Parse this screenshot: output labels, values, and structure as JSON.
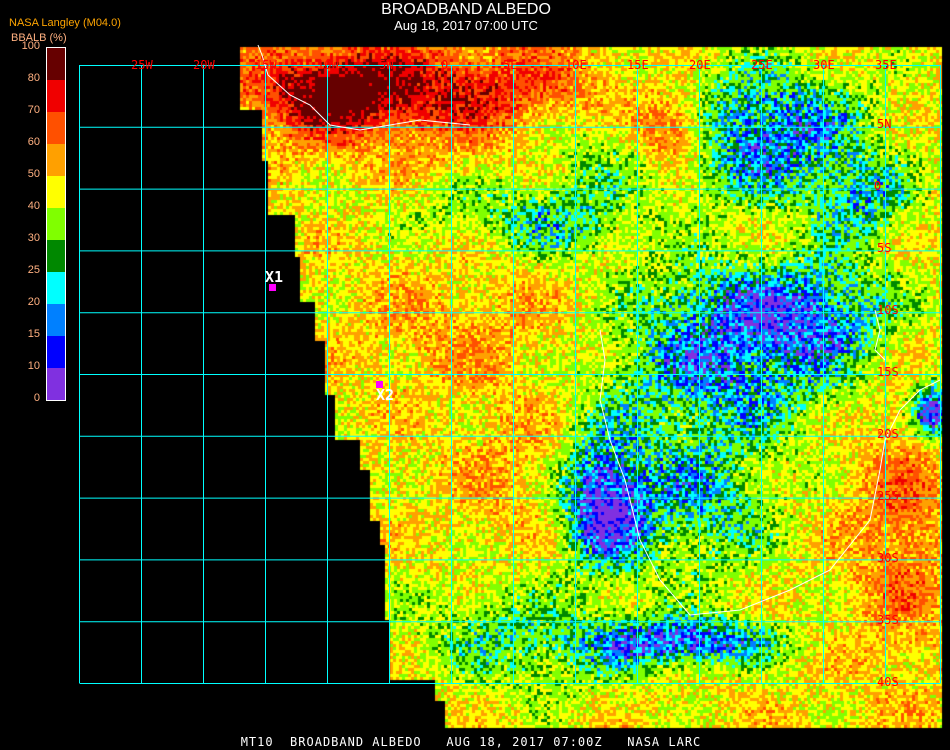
{
  "header": {
    "title": "BROADBAND ALBEDO",
    "subtitle": "Aug 18, 2017 07:00 UTC",
    "source": "NASA Langley (M04.0)"
  },
  "legend": {
    "units": "BBALB (%)",
    "ticks": [
      "100",
      "80",
      "70",
      "60",
      "50",
      "40",
      "30",
      "25",
      "20",
      "15",
      "10",
      "0"
    ],
    "bins": [
      {
        "range": [
          80,
          100
        ],
        "color": "#660000"
      },
      {
        "range": [
          70,
          80
        ],
        "color": "#f00000"
      },
      {
        "range": [
          60,
          70
        ],
        "color": "#ff5000"
      },
      {
        "range": [
          50,
          60
        ],
        "color": "#ffa000"
      },
      {
        "range": [
          40,
          50
        ],
        "color": "#ffff00"
      },
      {
        "range": [
          30,
          40
        ],
        "color": "#80ff00"
      },
      {
        "range": [
          25,
          30
        ],
        "color": "#008800"
      },
      {
        "range": [
          20,
          25
        ],
        "color": "#00ffff"
      },
      {
        "range": [
          15,
          20
        ],
        "color": "#0080ff"
      },
      {
        "range": [
          10,
          15
        ],
        "color": "#0000ff"
      },
      {
        "range": [
          0,
          10
        ],
        "color": "#8030e0"
      }
    ]
  },
  "map": {
    "grid_color": "#00ffff",
    "label_color": "#ff0000",
    "longitude_labels": [
      "25W",
      "20W",
      "15W",
      "10W",
      "5W",
      "0",
      "5E",
      "10E",
      "15E",
      "20E",
      "25E",
      "30E",
      "35E"
    ],
    "latitude_labels": [
      "5N",
      "0",
      "5S",
      "10S",
      "15S",
      "20S",
      "25S",
      "30S",
      "35S",
      "40S"
    ],
    "markers": [
      {
        "label": "X1",
        "color": "#ff00ff"
      },
      {
        "label": "X2",
        "color": "#ff00ff"
      }
    ]
  },
  "footer": {
    "text": "MT10  BROADBAND ALBEDO   AUG 18, 2017 07:00Z   NASA LARC"
  }
}
